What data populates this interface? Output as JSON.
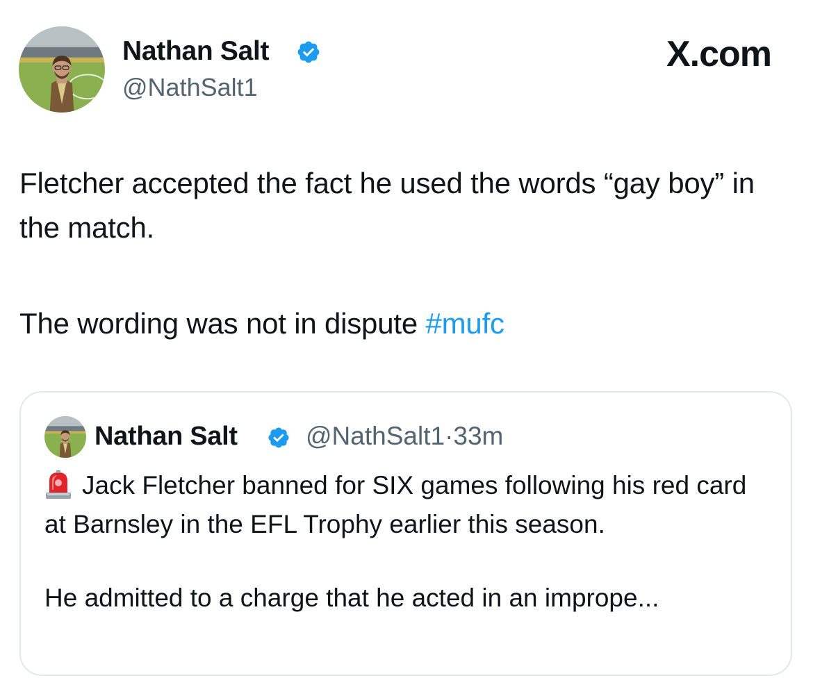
{
  "author": {
    "name": "Nathan Salt",
    "handle": "@NathSalt1",
    "avatar_icon": "profile-photo-stadium",
    "verified_icon": "verified-badge-icon"
  },
  "site_label": "X.com",
  "tweet": {
    "paragraph_1": "Fletcher accepted the fact he used the words “gay boy” in the match.",
    "paragraph_2_text": "The wording was not in dispute ",
    "hashtag": "#mufc"
  },
  "quoted_tweet": {
    "name": "Nathan Salt",
    "handle": "@NathSalt1",
    "separator": "·",
    "time": "33m",
    "emoji_icon": "rotating-light-icon",
    "paragraph_1": "Jack Fletcher banned for SIX games following his red card at Barnsley in the EFL Trophy earlier this season.",
    "paragraph_2": "He admitted to a charge that he acted in an imprope..."
  },
  "colors": {
    "text": "#0f1419",
    "secondary": "#536471",
    "link": "#1d9bf0",
    "verified": "#1d9bf0",
    "border": "#e3e7ea"
  }
}
